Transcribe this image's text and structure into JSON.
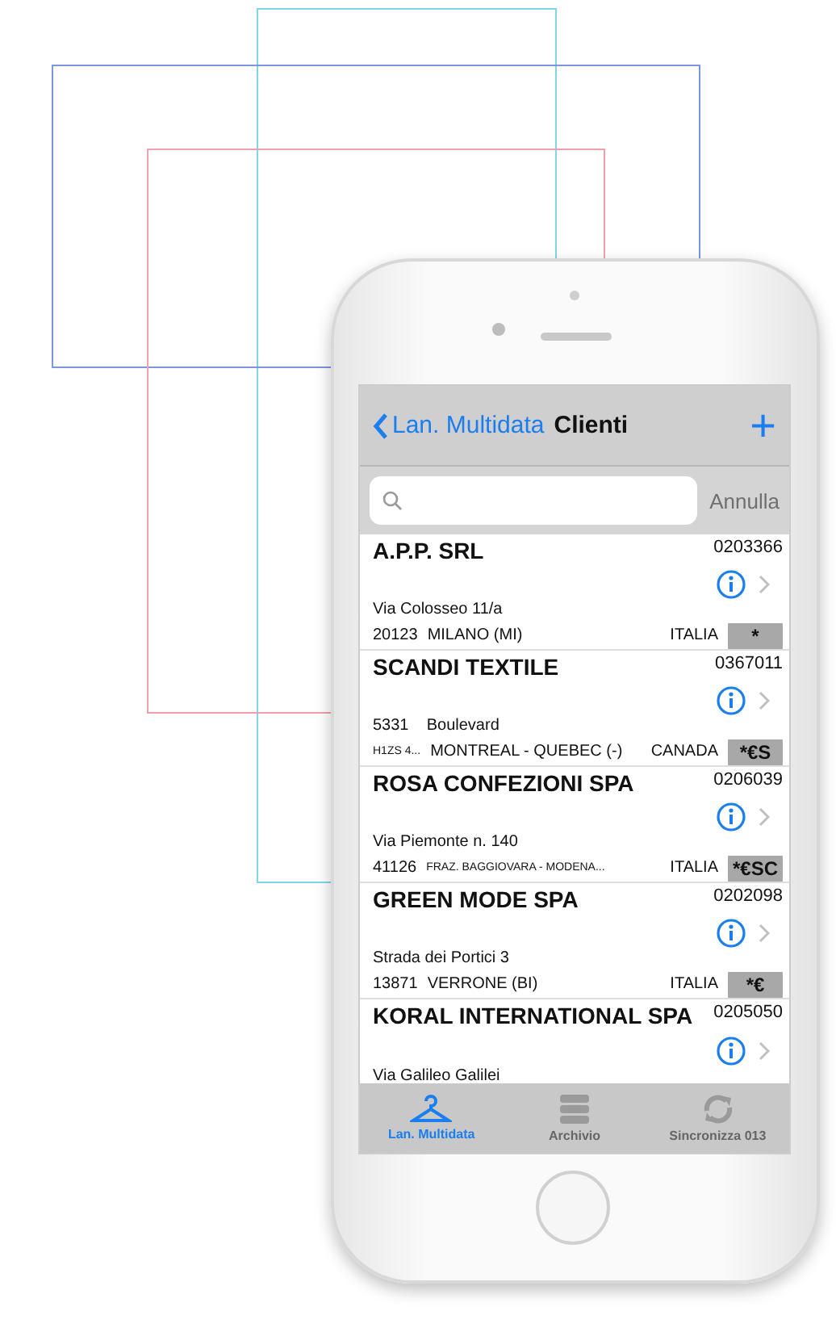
{
  "nav": {
    "back": "Lan. Multidata",
    "title": "Clienti",
    "add": "+"
  },
  "search": {
    "cancel": "Annulla"
  },
  "clients": [
    {
      "name": "A.P.P. SRL",
      "code": "0203366",
      "address": "Via Colosseo 11/a",
      "postal": "20123",
      "postal_small": false,
      "city": "MILANO (MI)",
      "city_small": false,
      "country": "ITALIA",
      "badge": "*"
    },
    {
      "name": "SCANDI TEXTILE",
      "code": "0367011",
      "address": "5331    Boulevard",
      "postal": "H1ZS 4...",
      "postal_small": true,
      "city": "MONTREAL - QUEBEC (-)",
      "city_small": false,
      "country": "CANADA",
      "badge": "*€S"
    },
    {
      "name": "ROSA CONFEZIONI SPA",
      "code": "0206039",
      "address": "Via Piemonte n. 140",
      "postal": "41126",
      "postal_small": false,
      "city": "FRAZ. BAGGIOVARA - MODENA...",
      "city_small": true,
      "country": "ITALIA",
      "badge": "*€SC"
    },
    {
      "name": "GREEN MODE SPA",
      "code": "0202098",
      "address": "Strada dei Portici 3",
      "postal": "13871",
      "postal_small": false,
      "city": "VERRONE (BI)",
      "city_small": false,
      "country": "ITALIA",
      "badge": "*€"
    },
    {
      "name": "KORAL INTERNATIONAL SPA",
      "code": "0205050",
      "address": "Via Galileo Galilei"
    }
  ],
  "tabs": [
    {
      "kind": "hanger",
      "label": "Lan. Multidata",
      "selected": true
    },
    {
      "kind": "archive",
      "label": "Archivio",
      "selected": false
    },
    {
      "kind": "sync",
      "label": "Sincronizza 013",
      "selected": false
    }
  ]
}
